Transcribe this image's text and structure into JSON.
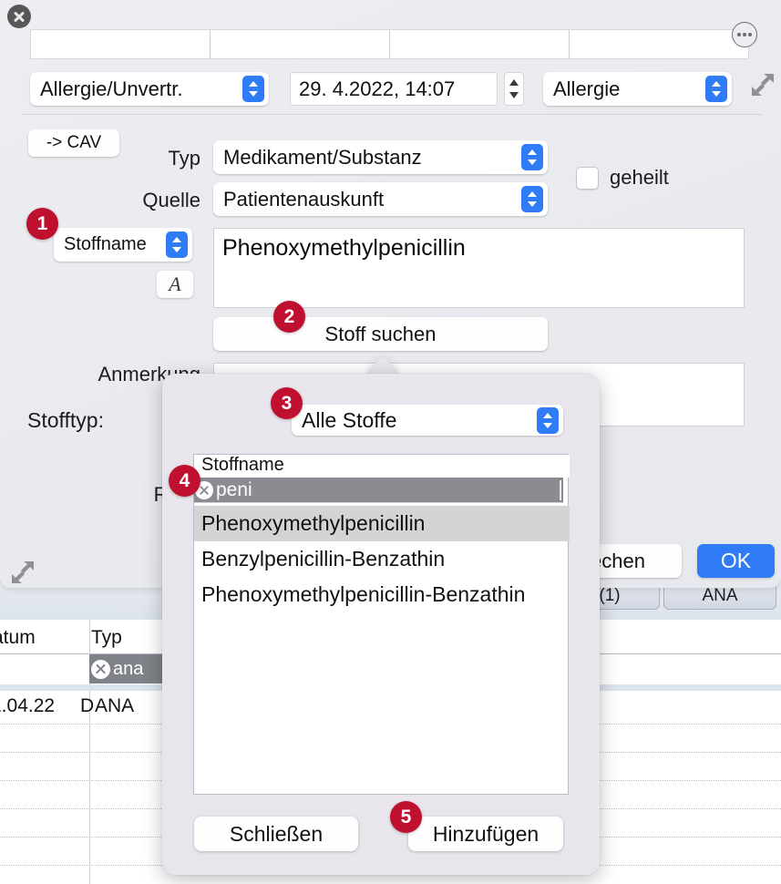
{
  "close_button": "close-window",
  "toolbar": {
    "segments": [
      "",
      "",
      "",
      ""
    ],
    "more_button": "more-options"
  },
  "header": {
    "category_popup": "Allergie/Unvertr.",
    "date_value": "29.  4.2022, 14:07",
    "kind_popup": "Allergie"
  },
  "form": {
    "cav_button": "-> CAV",
    "typ_label": "Typ",
    "typ_value": "Medikament/Substanz",
    "quelle_label": "Quelle",
    "quelle_value": "Patientenauskunft",
    "geheilt_label": "geheilt",
    "stoffname_popup": "Stoffname",
    "format_button": "A",
    "substance_text": "Phenoxymethylpenicillin",
    "stoff_suchen_button": "Stoff suchen",
    "anmerkung_label": "Anmerkung",
    "anmerkung_value": "",
    "reaktion_label": "Reak"
  },
  "dialog_buttons": {
    "cancel": "echen",
    "ok": "OK"
  },
  "popover": {
    "stofftyp_label": "Stofftyp:",
    "stofftyp_value": "Alle Stoffe",
    "list_header": "Stoffname",
    "search_value": "peni",
    "items": [
      {
        "label": "Phenoxymethylpenicillin",
        "selected": true
      },
      {
        "label": "Benzylpenicillin-Benzathin",
        "selected": false
      },
      {
        "label": "Phenoxymethylpenicillin-Benzathin",
        "selected": false
      }
    ],
    "close_button": "Schließen",
    "add_button": "Hinzufügen"
  },
  "background": {
    "tabs": [
      "(1)",
      "ANA"
    ],
    "columns": [
      "atum",
      "Typ"
    ],
    "filter_value": "ana",
    "row": {
      "date": "1.04.22",
      "typ_prefix": "D",
      "typ": "ANA"
    }
  },
  "badges": [
    "1",
    "2",
    "3",
    "4",
    "5"
  ],
  "colors": {
    "badge_red": "#c01030",
    "accent_blue": "#2f7cf6",
    "selection_gray": "#8a8c91"
  }
}
